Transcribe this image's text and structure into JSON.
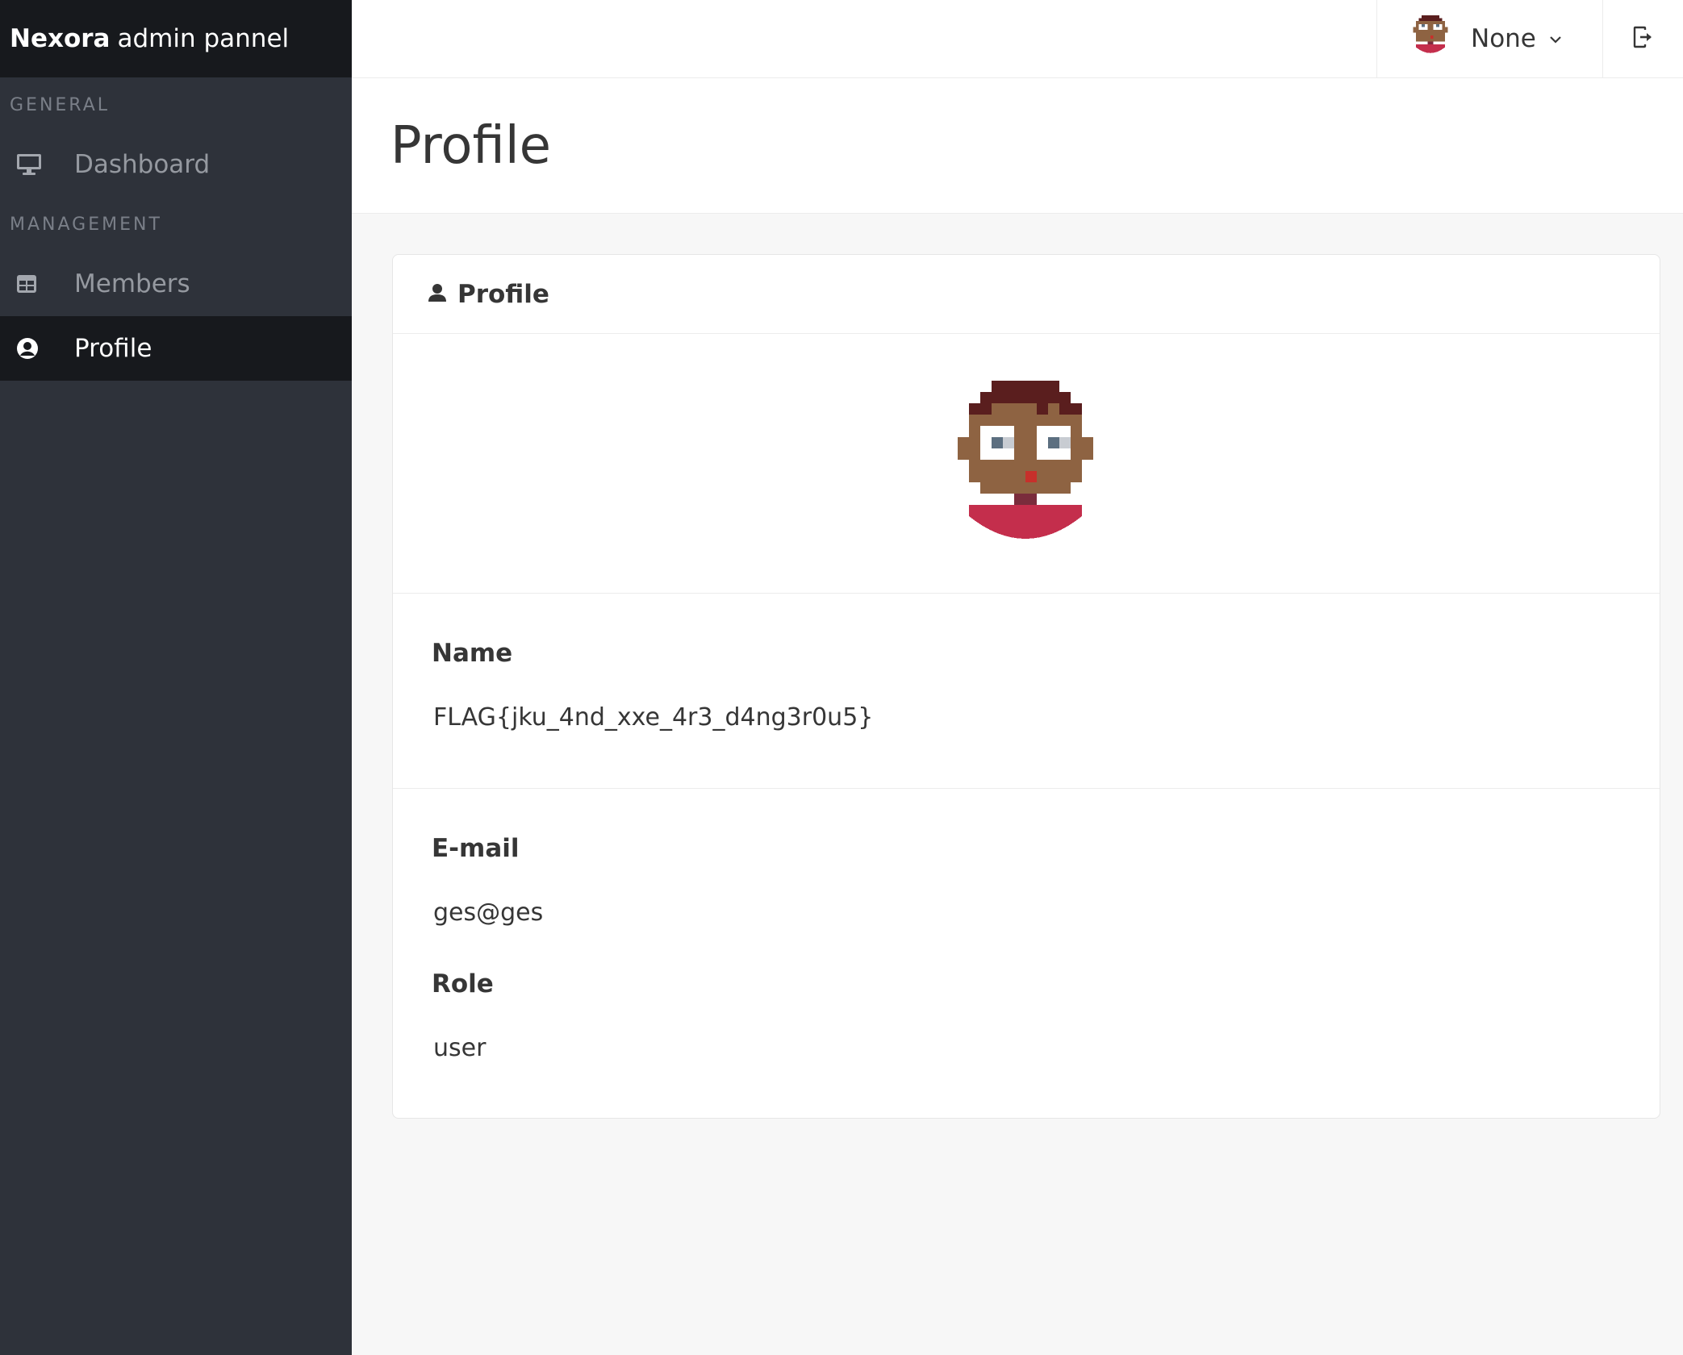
{
  "brand": {
    "strong": "Nexora",
    "rest": "admin pannel"
  },
  "sidebar": {
    "sections": [
      {
        "label": "GENERAL"
      },
      {
        "label": "MANAGEMENT"
      }
    ],
    "items": [
      {
        "label": "Dashboard",
        "icon": "desktop-icon"
      },
      {
        "label": "Members",
        "icon": "table-icon"
      },
      {
        "label": "Profile",
        "icon": "user-circle-icon",
        "active": true
      }
    ]
  },
  "navbar": {
    "user_name": "None",
    "avatar_icon": "pixel-avatar-icon",
    "dropdown_icon": "chevron-down-icon",
    "logout_icon": "logout-icon"
  },
  "page": {
    "title": "Profile"
  },
  "card": {
    "header": "Profile",
    "header_icon": "user-icon",
    "fields": {
      "name_label": "Name",
      "name_value": "FLAG{jku_4nd_xxe_4r3_d4ng3r0u5}",
      "email_label": "E-mail",
      "email_value": "ges@ges",
      "role_label": "Role",
      "role_value": "user"
    }
  },
  "colors": {
    "sidebar_bg": "#2e323a",
    "brand_bg": "#17191d",
    "skin": "#8e6342",
    "hair": "#5a1e1e",
    "shirt": "#c42e4c"
  }
}
